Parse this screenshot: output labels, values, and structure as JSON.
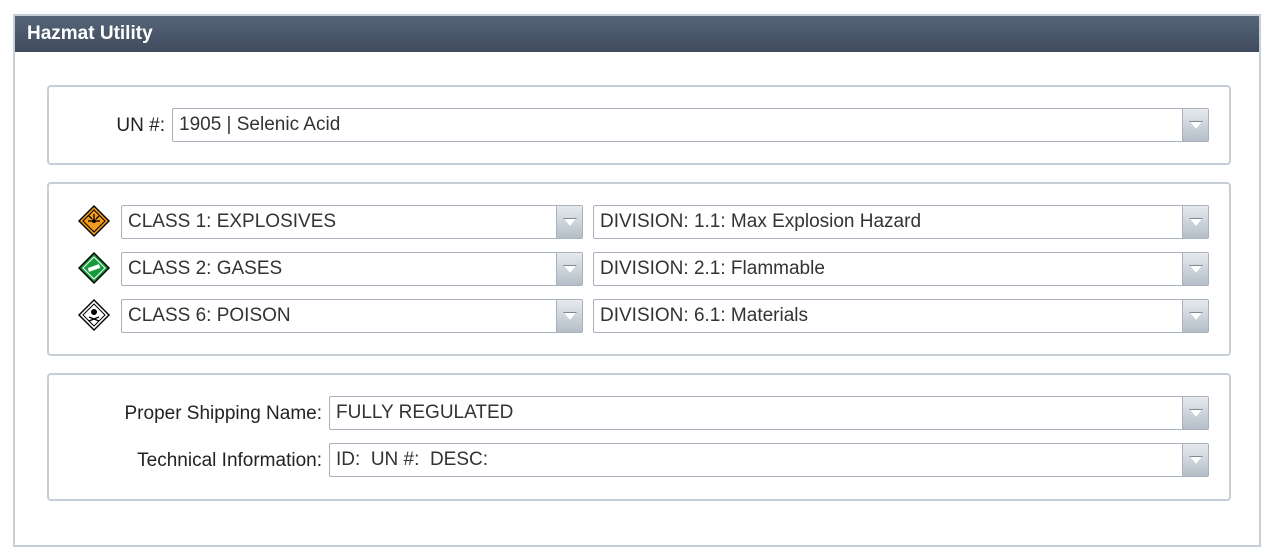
{
  "window": {
    "title": "Hazmat Utility"
  },
  "un": {
    "label": "UN #:",
    "value": "1905 | Selenic Acid"
  },
  "hazards": [
    {
      "icon": "explosive-placard-icon",
      "class_value": "CLASS 1: EXPLOSIVES",
      "division_value": "DIVISION: 1.1: Max Explosion Hazard",
      "color": "#f39b1e"
    },
    {
      "icon": "flammable-gas-placard-icon",
      "class_value": "CLASS 2: GASES",
      "division_value": "DIVISION: 2.1: Flammable",
      "color": "#169b3c"
    },
    {
      "icon": "poison-placard-icon",
      "class_value": "CLASS 6: POISON",
      "division_value": "DIVISION: 6.1: Materials",
      "color": "#ffffff"
    }
  ],
  "shipping": {
    "proper_name_label": "Proper Shipping Name:",
    "proper_name_value": "FULLY REGULATED",
    "technical_label": "Technical Information:",
    "technical_value": "ID:  UN #:  DESC:"
  },
  "colors": {
    "titlebar": "#4a5669",
    "border": "#c8ced6"
  }
}
